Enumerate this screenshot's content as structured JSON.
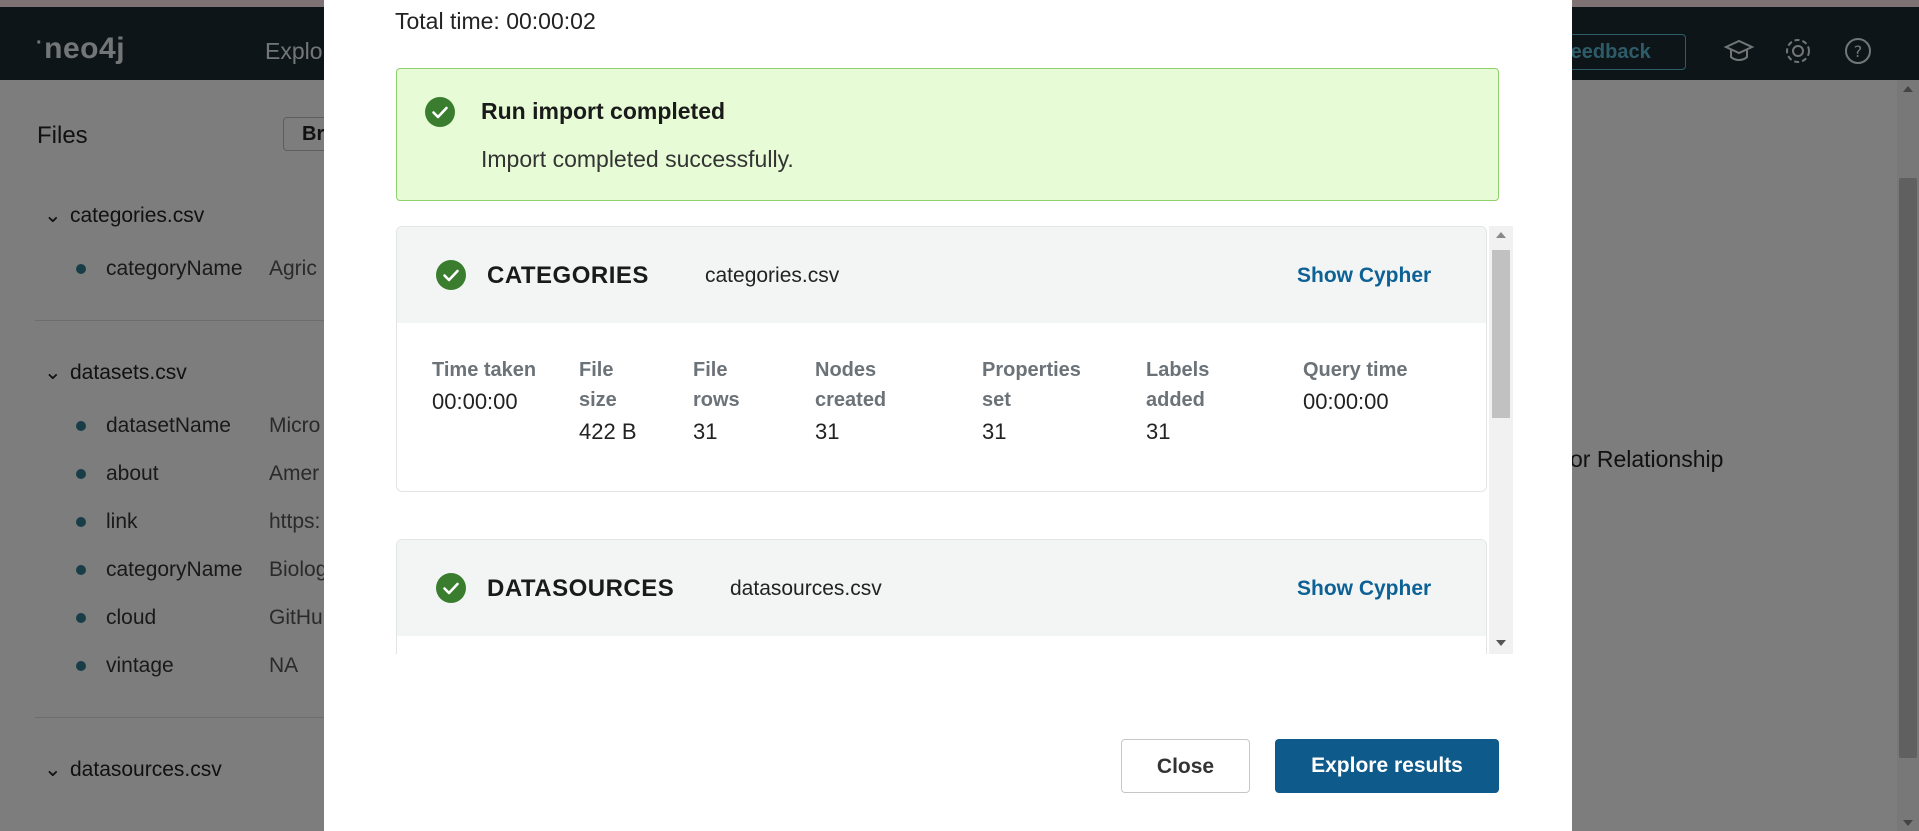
{
  "app": {
    "logo": "neo4j",
    "nav_explore": "Explo",
    "feedback_label": "feedback",
    "icons": [
      "graduation-cap-icon",
      "gear-icon",
      "help-icon"
    ]
  },
  "files_panel": {
    "title": "Files",
    "browse_label": "Br",
    "files": [
      {
        "name": "categories.csv",
        "props": [
          {
            "name": "categoryName",
            "value": "Agric"
          }
        ]
      },
      {
        "name": "datasets.csv",
        "props": [
          {
            "name": "datasetName",
            "value": "Micro"
          },
          {
            "name": "about",
            "value": "Amer"
          },
          {
            "name": "link",
            "value": "https:"
          },
          {
            "name": "categoryName",
            "value": "Biolog"
          },
          {
            "name": "cloud",
            "value": "GitHu"
          },
          {
            "name": "vintage",
            "value": "NA"
          }
        ]
      },
      {
        "name": "datasources.csv",
        "props": []
      }
    ],
    "right_text": "or Relationship"
  },
  "modal": {
    "total_time": "Total time: 00:00:02",
    "success": {
      "title": "Run import completed",
      "message": "Import completed successfully."
    },
    "results": [
      {
        "label": "CATEGORIES",
        "file": "categories.csv",
        "show_cypher": "Show Cypher",
        "stats": {
          "time_taken_label": "Time taken",
          "time_taken": "00:00:00",
          "file_size_label": "File size",
          "file_size": "422 B",
          "file_rows_label": "File rows",
          "file_rows": "31",
          "nodes_created_label": "Nodes created",
          "nodes_created": "31",
          "properties_set_label": "Properties set",
          "properties_set": "31",
          "labels_added_label": "Labels added",
          "labels_added": "31",
          "query_time_label": "Query time",
          "query_time": "00:00:00"
        }
      },
      {
        "label": "DATASOURCES",
        "file": "datasources.csv",
        "show_cypher": "Show Cypher"
      }
    ],
    "close_label": "Close",
    "explore_label": "Explore results"
  },
  "colors": {
    "navbar": "#1c2a33",
    "success_bg": "#e6fbd6",
    "success_border": "#8fd16b",
    "check_green": "#3a7d2f",
    "link_blue": "#0d6195",
    "primary_button": "#0e5a8a"
  }
}
